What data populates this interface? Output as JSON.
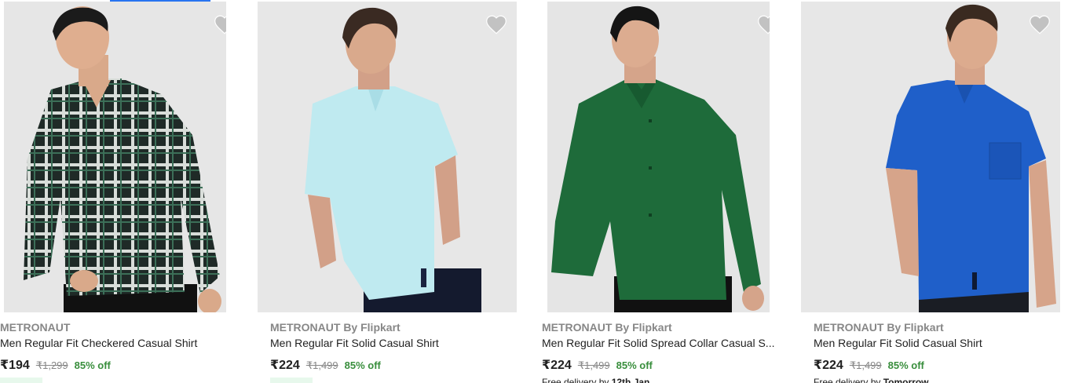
{
  "products": [
    {
      "brand": "METRONAUT",
      "title": "Men Regular Fit Checkered Casual Shirt",
      "price": "₹194",
      "mrp": "₹1,299",
      "discount": "85% off",
      "shirt_color": "checkered black/green"
    },
    {
      "brand": "METRONAUT By Flipkart",
      "title": "Men Regular Fit Solid Casual Shirt",
      "price": "₹224",
      "mrp": "₹1,499",
      "discount": "85% off",
      "shirt_color": "#bfeaf0"
    },
    {
      "brand": "METRONAUT By Flipkart",
      "title": "Men Regular Fit Solid Spread Collar Casual S...",
      "price": "₹224",
      "mrp": "₹1,499",
      "discount": "85% off",
      "delivery_prefix": "Free delivery by ",
      "delivery_date": "12th Jan",
      "shirt_color": "#1e6b3a"
    },
    {
      "brand": "METRONAUT By Flipkart",
      "title": "Men Regular Fit Solid Casual Shirt",
      "price": "₹224",
      "mrp": "₹1,499",
      "discount": "85% off",
      "delivery_prefix": "Free delivery by ",
      "delivery_date": "Tomorrow",
      "shirt_color": "#1f5fc9"
    }
  ],
  "colors": {
    "accent": "#2874f0",
    "discount_green": "#388e3c",
    "wishlist_icon": "#c2c2c2",
    "brand_grey": "#878787"
  }
}
